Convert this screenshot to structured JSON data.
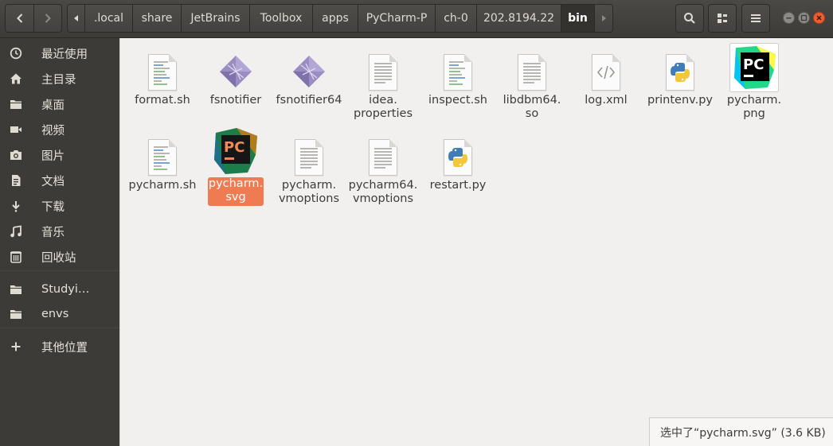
{
  "header": {
    "breadcrumbs": [
      ".local",
      "share",
      "JetBrains",
      "Toolbox",
      "apps",
      "PyCharm-P",
      "ch-0",
      "202.8194.22",
      "bin"
    ],
    "active_crumb": "bin"
  },
  "sidebar": {
    "items": [
      {
        "label": "最近使用",
        "icon": "clock-icon"
      },
      {
        "label": "主目录",
        "icon": "home-icon"
      },
      {
        "label": "桌面",
        "icon": "folder-icon"
      },
      {
        "label": "视频",
        "icon": "video-icon"
      },
      {
        "label": "图片",
        "icon": "camera-icon"
      },
      {
        "label": "文档",
        "icon": "document-icon"
      },
      {
        "label": "下载",
        "icon": "download-icon"
      },
      {
        "label": "音乐",
        "icon": "music-icon"
      },
      {
        "label": "回收站",
        "icon": "trash-icon"
      },
      {
        "label": "Studyi…",
        "icon": "folder-icon"
      },
      {
        "label": "envs",
        "icon": "folder-icon"
      },
      {
        "label": "其他位置",
        "icon": "plus-icon"
      }
    ]
  },
  "files": [
    {
      "name1": "format.sh",
      "name2": "",
      "icon": "script-icon"
    },
    {
      "name1": "fsnotifier",
      "name2": "",
      "icon": "executable-icon"
    },
    {
      "name1": "fsnotifier64",
      "name2": "",
      "icon": "executable-icon"
    },
    {
      "name1": "idea.",
      "name2": "properties",
      "icon": "text-file-icon"
    },
    {
      "name1": "inspect.sh",
      "name2": "",
      "icon": "script-icon"
    },
    {
      "name1": "libdbm64.",
      "name2": "so",
      "icon": "text-file-icon"
    },
    {
      "name1": "log.xml",
      "name2": "",
      "icon": "xml-icon"
    },
    {
      "name1": "printenv.py",
      "name2": "",
      "icon": "python-icon"
    },
    {
      "name1": "pycharm.",
      "name2": "png",
      "icon": "pycharm-logo-icon"
    },
    {
      "name1": "pycharm.sh",
      "name2": "",
      "icon": "script-icon"
    },
    {
      "name1": "pycharm.",
      "name2": "svg",
      "icon": "pycharm-logo-icon"
    },
    {
      "name1": "pycharm.",
      "name2": "vmoptions",
      "icon": "text-file-icon"
    },
    {
      "name1": "pycharm64.",
      "name2": "vmoptions",
      "icon": "text-file-icon"
    },
    {
      "name1": "restart.py",
      "name2": "",
      "icon": "python-icon"
    }
  ],
  "selected_file": "pycharm.svg",
  "status": {
    "text": "选中了“pycharm.svg” (3.6 KB)"
  },
  "colors": {
    "selection": "#ee7b52",
    "sidebar_bg": "#3c3b37",
    "close_button": "#ef5d2e"
  }
}
